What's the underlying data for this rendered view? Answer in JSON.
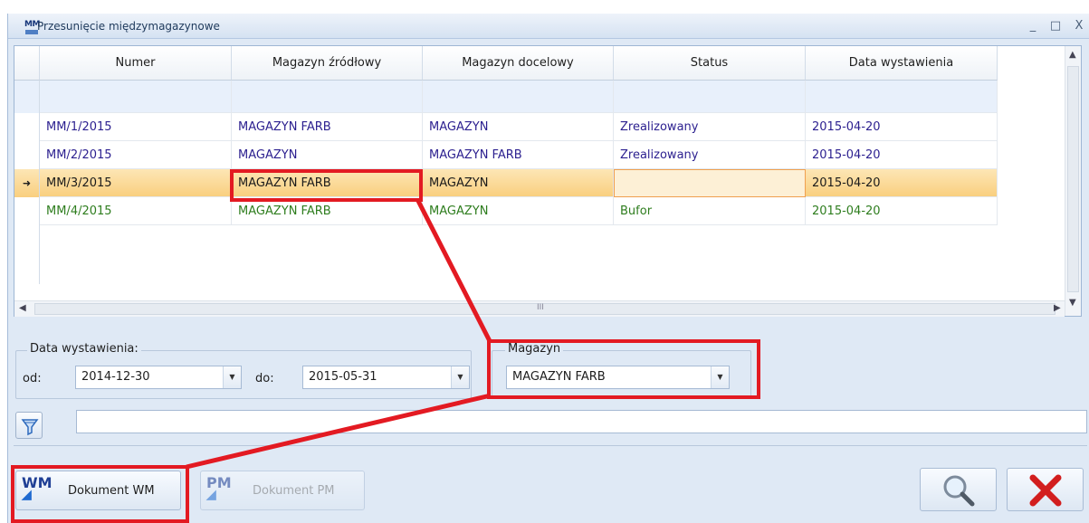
{
  "window": {
    "icon_text": "MM",
    "title": "Przesunięcie międzymagazynowe",
    "minimize": "_",
    "maximize": "□",
    "close": "X"
  },
  "grid": {
    "columns": [
      "Numer",
      "Magazyn źródłowy",
      "Magazyn docelowy",
      "Status",
      "Data wystawienia"
    ],
    "rows": [
      {
        "numer": "MM/1/2015",
        "zrodlowy": "MAGAZYN FARB",
        "docelowy": "MAGAZYN",
        "status": "Zrealizowany",
        "data": "2015-04-20"
      },
      {
        "numer": "MM/2/2015",
        "zrodlowy": "MAGAZYN",
        "docelowy": "MAGAZYN FARB",
        "status": "Zrealizowany",
        "data": "2015-04-20"
      },
      {
        "numer": "MM/3/2015",
        "zrodlowy": "MAGAZYN FARB",
        "docelowy": "MAGAZYN",
        "status": "",
        "data": "2015-04-20"
      },
      {
        "numer": "MM/4/2015",
        "zrodlowy": "MAGAZYN FARB",
        "docelowy": "MAGAZYN",
        "status": "Bufor",
        "data": "2015-04-20"
      }
    ],
    "current_row_marker": "➜",
    "hscroll_grip": "III"
  },
  "filters": {
    "date_group_label": "Data wystawienia:",
    "from_label": "od:",
    "from_value": "2014-12-30",
    "to_label": "do:",
    "to_value": "2015-05-31",
    "warehouse_group_label": "Magazyn",
    "warehouse_value": "MAGAZYN FARB"
  },
  "search": {
    "value": ""
  },
  "buttons": {
    "wm_icon": "WM",
    "wm_label": "Dokument WM",
    "pm_icon": "PM",
    "pm_label": "Dokument PM"
  },
  "colors": {
    "highlight": "#e31a22",
    "selected_row": "#f9cf7f",
    "purple_text": "#2b1f8f",
    "green_text": "#2e7d1e"
  }
}
